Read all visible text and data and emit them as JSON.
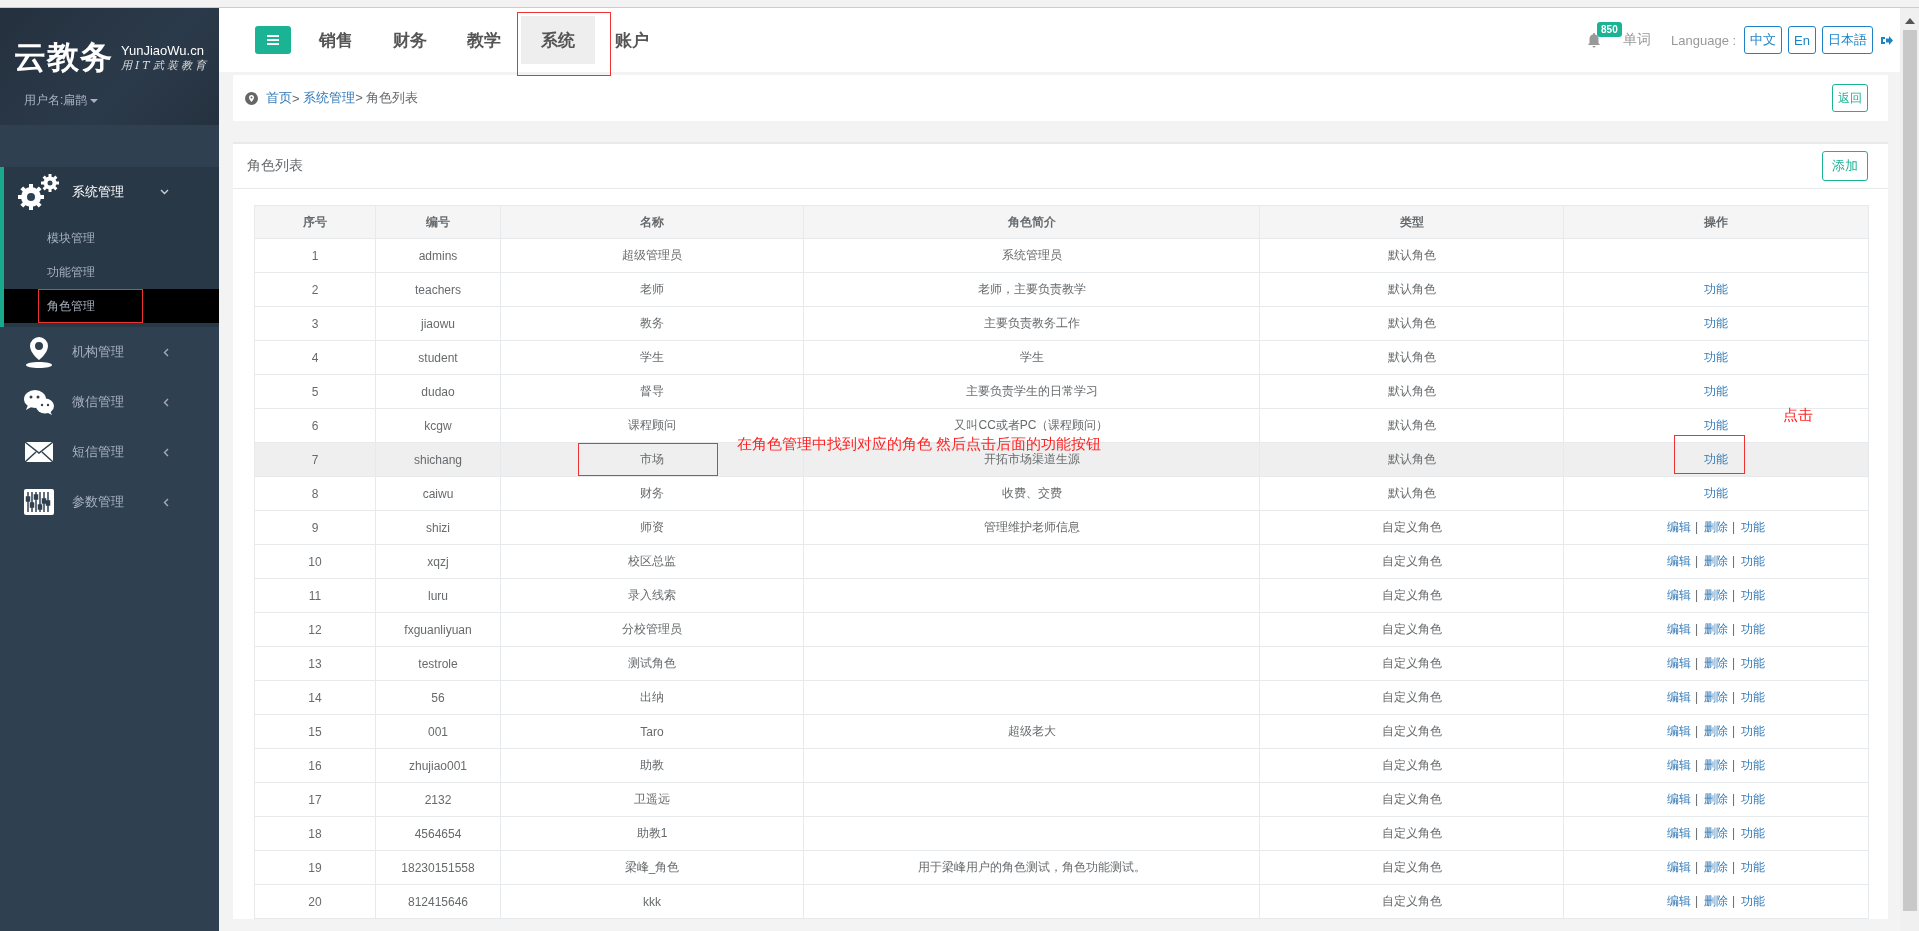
{
  "sidebar": {
    "logo": {
      "title": "云教务",
      "domain": "YunJiaoWu.cn",
      "slogan": "用IT武装教育"
    },
    "user": "用户名:扁鹊",
    "menu": [
      {
        "label": "系统管理",
        "expanded": true,
        "children": [
          {
            "label": "模块管理",
            "selected": false,
            "framed": false
          },
          {
            "label": "功能管理",
            "selected": false,
            "framed": false
          },
          {
            "label": "角色管理",
            "selected": true,
            "framed": true
          }
        ]
      },
      {
        "label": "机构管理",
        "expanded": false
      },
      {
        "label": "微信管理",
        "expanded": false
      },
      {
        "label": "短信管理",
        "expanded": false
      },
      {
        "label": "参数管理",
        "expanded": false
      }
    ]
  },
  "topbar": {
    "tabs": [
      {
        "label": "销售",
        "selected": false,
        "framed": false
      },
      {
        "label": "财务",
        "selected": false,
        "framed": false
      },
      {
        "label": "教学",
        "selected": false,
        "framed": false
      },
      {
        "label": "系统",
        "selected": true,
        "framed": true
      },
      {
        "label": "账户",
        "selected": false,
        "framed": false
      }
    ],
    "notifications": "850",
    "words": "单词",
    "language_label": "Language :",
    "languages": [
      "中文",
      "En",
      "日本語"
    ]
  },
  "breadcrumb": {
    "items": [
      {
        "label": "首页",
        "kind": "link"
      },
      {
        "label": ">",
        "kind": "text"
      },
      {
        "label": "系统管理",
        "kind": "link"
      },
      {
        "label": "> 角色列表",
        "kind": "text"
      }
    ],
    "back": "返回"
  },
  "panel": {
    "title": "角色列表",
    "add": "添加"
  },
  "table": {
    "columns": [
      "序号",
      "编号",
      "名称",
      "角色简介",
      "类型",
      "操作"
    ],
    "separator": "|",
    "rows": [
      {
        "cells": [
          "1",
          "admins",
          "超级管理员",
          "系统管理员",
          "默认角色"
        ],
        "selected": false,
        "name_framed": false,
        "action_framed": false
      },
      {
        "cells": [
          "2",
          "teachers",
          "老师",
          "老师，主要负责教学",
          "默认角色"
        ],
        "actions": [
          "功能"
        ],
        "selected": false,
        "name_framed": false,
        "action_framed": false
      },
      {
        "cells": [
          "3",
          "jiaowu",
          "教务",
          "主要负责教务工作",
          "默认角色"
        ],
        "actions": [
          "功能"
        ],
        "selected": false,
        "name_framed": false,
        "action_framed": false
      },
      {
        "cells": [
          "4",
          "student",
          "学生",
          "学生",
          "默认角色"
        ],
        "actions": [
          "功能"
        ],
        "selected": false,
        "name_framed": false,
        "action_framed": false
      },
      {
        "cells": [
          "5",
          "dudao",
          "督导",
          "主要负责学生的日常学习",
          "默认角色"
        ],
        "actions": [
          "功能"
        ],
        "selected": false,
        "name_framed": false,
        "action_framed": false
      },
      {
        "cells": [
          "6",
          "kcgw",
          "课程顾问",
          "又叫CC或者PC（课程顾问）",
          "默认角色"
        ],
        "actions": [
          "功能"
        ],
        "selected": false,
        "name_framed": false,
        "action_framed": false
      },
      {
        "cells": [
          "7",
          "shichang",
          "市场",
          "开拓市场渠道生源",
          "默认角色"
        ],
        "actions": [
          "功能"
        ],
        "selected": true,
        "name_framed": true,
        "action_framed": true
      },
      {
        "cells": [
          "8",
          "caiwu",
          "财务",
          "收费、交费",
          "默认角色"
        ],
        "actions": [
          "功能"
        ],
        "selected": false,
        "name_framed": false,
        "action_framed": false
      },
      {
        "cells": [
          "9",
          "shizi",
          "师资",
          "管理维护老师信息",
          "自定义角色"
        ],
        "actions": [
          "编辑",
          "删除",
          "功能"
        ],
        "selected": false,
        "name_framed": false,
        "action_framed": false
      },
      {
        "cells": [
          "10",
          "xqzj",
          "校区总监",
          "",
          "自定义角色"
        ],
        "actions": [
          "编辑",
          "删除",
          "功能"
        ],
        "selected": false,
        "name_framed": false,
        "action_framed": false
      },
      {
        "cells": [
          "11",
          "luru",
          "录入线索",
          "",
          "自定义角色"
        ],
        "actions": [
          "编辑",
          "删除",
          "功能"
        ],
        "selected": false,
        "name_framed": false,
        "action_framed": false
      },
      {
        "cells": [
          "12",
          "fxguanliyuan",
          "分校管理员",
          "",
          "自定义角色"
        ],
        "actions": [
          "编辑",
          "删除",
          "功能"
        ],
        "selected": false,
        "name_framed": false,
        "action_framed": false
      },
      {
        "cells": [
          "13",
          "testrole",
          "测试角色",
          "",
          "自定义角色"
        ],
        "actions": [
          "编辑",
          "删除",
          "功能"
        ],
        "selected": false,
        "name_framed": false,
        "action_framed": false
      },
      {
        "cells": [
          "14",
          "56",
          "出纳",
          "",
          "自定义角色"
        ],
        "actions": [
          "编辑",
          "删除",
          "功能"
        ],
        "selected": false,
        "name_framed": false,
        "action_framed": false
      },
      {
        "cells": [
          "15",
          "001",
          "Taro",
          "超级老大",
          "自定义角色"
        ],
        "actions": [
          "编辑",
          "删除",
          "功能"
        ],
        "selected": false,
        "name_framed": false,
        "action_framed": false
      },
      {
        "cells": [
          "16",
          "zhujiao001",
          "助教",
          "",
          "自定义角色"
        ],
        "actions": [
          "编辑",
          "删除",
          "功能"
        ],
        "selected": false,
        "name_framed": false,
        "action_framed": false
      },
      {
        "cells": [
          "17",
          "2132",
          "卫遥远",
          "",
          "自定义角色"
        ],
        "actions": [
          "编辑",
          "删除",
          "功能"
        ],
        "selected": false,
        "name_framed": false,
        "action_framed": false
      },
      {
        "cells": [
          "18",
          "4564654",
          "助教1",
          "",
          "自定义角色"
        ],
        "actions": [
          "编辑",
          "删除",
          "功能"
        ],
        "selected": false,
        "name_framed": false,
        "action_framed": false
      },
      {
        "cells": [
          "19",
          "18230151558",
          "梁峰_角色",
          "用于梁峰用户的角色测试，角色功能测试。",
          "自定义角色"
        ],
        "actions": [
          "编辑",
          "删除",
          "功能"
        ],
        "selected": false,
        "name_framed": false,
        "action_framed": false
      },
      {
        "cells": [
          "20",
          "812415646",
          "kkk",
          "",
          "自定义角色"
        ],
        "actions": [
          "编辑",
          "删除",
          "功能"
        ],
        "selected": false,
        "name_framed": false,
        "action_framed": false
      }
    ]
  },
  "annotations": [
    {
      "kind": "instruction",
      "text": "在角色管理中找到对应的角色 然后点击后面的功能按钮"
    },
    {
      "kind": "callout",
      "text": "点击"
    }
  ]
}
